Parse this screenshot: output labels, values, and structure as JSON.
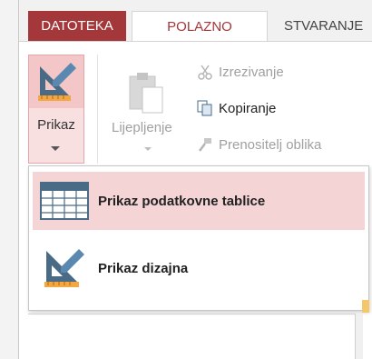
{
  "tabs": {
    "file": "DATOTEKA",
    "home": "POLAZNO",
    "create": "STVARANJE"
  },
  "ribbon": {
    "view_label": "Prikaz",
    "paste_label": "Lijepljenje",
    "cut_label": "Izrezivanje",
    "copy_label": "Kopiranje",
    "format_painter_label": "Prenositelj oblika"
  },
  "view_menu": {
    "items": [
      {
        "label": "Prikaz podatkovne tablice",
        "icon": "datasheet-view-icon"
      },
      {
        "label": "Prikaz dizajna",
        "icon": "design-view-icon"
      }
    ]
  },
  "colors": {
    "accent": "#a4373a",
    "highlight": "#f5d4d5"
  }
}
